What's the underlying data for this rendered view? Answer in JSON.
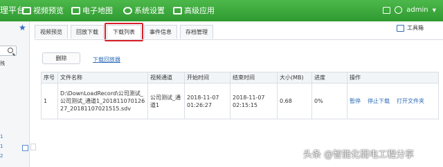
{
  "topbar": {
    "brand": "理平台",
    "nav": [
      "视频预览",
      "电子地图",
      "系统设置",
      "高级应用"
    ],
    "user": "admin"
  },
  "sidebar": {
    "small_text": "残",
    "nums": [
      "1",
      "1",
      "2"
    ]
  },
  "tabs": [
    "视频预览",
    "回放下载",
    "下载列表",
    "事件信息",
    "存档管理"
  ],
  "active_tab": "下载列表",
  "toolbox": "工具箱",
  "actions": {
    "delete": "删除",
    "download_player": "下载回放器"
  },
  "table": {
    "headers": [
      "序号",
      "文件名称",
      "视频通道",
      "开始时间",
      "结束时间",
      "大小(MB)",
      "进度",
      "操作"
    ],
    "rows": [
      {
        "index": "1",
        "filename": "D:\\DownLoadRecord\\公司测试_公司测试_通道1_20181107012627_20181107021515.sdv",
        "channel": "公司测试_通道1",
        "start": "2018-11-07 01:26:27",
        "end": "2018-11-07 02:15:15",
        "size": "0.68",
        "progress": "0%",
        "ops": [
          "暂停",
          "停止下载",
          "打开文件夹"
        ]
      }
    ]
  },
  "watermark": "头条 @智能化弱电工程分享",
  "colors": {
    "topbar": "#3aa83b",
    "link": "#2d6db6",
    "highlight": "#d71f26"
  }
}
